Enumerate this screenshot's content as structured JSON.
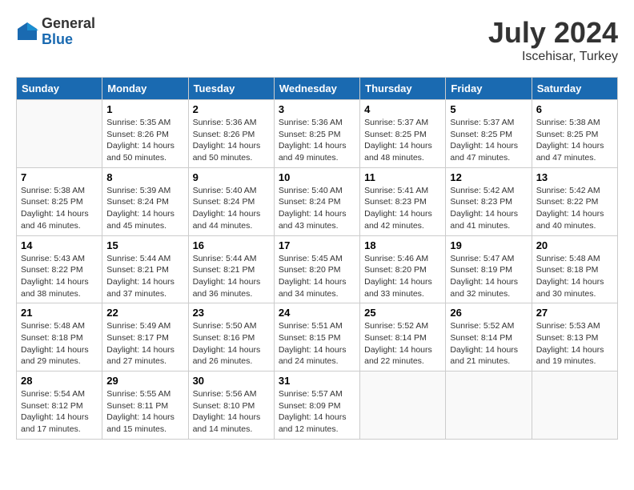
{
  "header": {
    "logo_general": "General",
    "logo_blue": "Blue",
    "month_title": "July 2024",
    "subtitle": "Iscehisar, Turkey"
  },
  "days_of_week": [
    "Sunday",
    "Monday",
    "Tuesday",
    "Wednesday",
    "Thursday",
    "Friday",
    "Saturday"
  ],
  "weeks": [
    [
      {
        "day": "",
        "info": ""
      },
      {
        "day": "1",
        "info": "Sunrise: 5:35 AM\nSunset: 8:26 PM\nDaylight: 14 hours\nand 50 minutes."
      },
      {
        "day": "2",
        "info": "Sunrise: 5:36 AM\nSunset: 8:26 PM\nDaylight: 14 hours\nand 50 minutes."
      },
      {
        "day": "3",
        "info": "Sunrise: 5:36 AM\nSunset: 8:25 PM\nDaylight: 14 hours\nand 49 minutes."
      },
      {
        "day": "4",
        "info": "Sunrise: 5:37 AM\nSunset: 8:25 PM\nDaylight: 14 hours\nand 48 minutes."
      },
      {
        "day": "5",
        "info": "Sunrise: 5:37 AM\nSunset: 8:25 PM\nDaylight: 14 hours\nand 47 minutes."
      },
      {
        "day": "6",
        "info": "Sunrise: 5:38 AM\nSunset: 8:25 PM\nDaylight: 14 hours\nand 47 minutes."
      }
    ],
    [
      {
        "day": "7",
        "info": "Sunrise: 5:38 AM\nSunset: 8:25 PM\nDaylight: 14 hours\nand 46 minutes."
      },
      {
        "day": "8",
        "info": "Sunrise: 5:39 AM\nSunset: 8:24 PM\nDaylight: 14 hours\nand 45 minutes."
      },
      {
        "day": "9",
        "info": "Sunrise: 5:40 AM\nSunset: 8:24 PM\nDaylight: 14 hours\nand 44 minutes."
      },
      {
        "day": "10",
        "info": "Sunrise: 5:40 AM\nSunset: 8:24 PM\nDaylight: 14 hours\nand 43 minutes."
      },
      {
        "day": "11",
        "info": "Sunrise: 5:41 AM\nSunset: 8:23 PM\nDaylight: 14 hours\nand 42 minutes."
      },
      {
        "day": "12",
        "info": "Sunrise: 5:42 AM\nSunset: 8:23 PM\nDaylight: 14 hours\nand 41 minutes."
      },
      {
        "day": "13",
        "info": "Sunrise: 5:42 AM\nSunset: 8:22 PM\nDaylight: 14 hours\nand 40 minutes."
      }
    ],
    [
      {
        "day": "14",
        "info": "Sunrise: 5:43 AM\nSunset: 8:22 PM\nDaylight: 14 hours\nand 38 minutes."
      },
      {
        "day": "15",
        "info": "Sunrise: 5:44 AM\nSunset: 8:21 PM\nDaylight: 14 hours\nand 37 minutes."
      },
      {
        "day": "16",
        "info": "Sunrise: 5:44 AM\nSunset: 8:21 PM\nDaylight: 14 hours\nand 36 minutes."
      },
      {
        "day": "17",
        "info": "Sunrise: 5:45 AM\nSunset: 8:20 PM\nDaylight: 14 hours\nand 34 minutes."
      },
      {
        "day": "18",
        "info": "Sunrise: 5:46 AM\nSunset: 8:20 PM\nDaylight: 14 hours\nand 33 minutes."
      },
      {
        "day": "19",
        "info": "Sunrise: 5:47 AM\nSunset: 8:19 PM\nDaylight: 14 hours\nand 32 minutes."
      },
      {
        "day": "20",
        "info": "Sunrise: 5:48 AM\nSunset: 8:18 PM\nDaylight: 14 hours\nand 30 minutes."
      }
    ],
    [
      {
        "day": "21",
        "info": "Sunrise: 5:48 AM\nSunset: 8:18 PM\nDaylight: 14 hours\nand 29 minutes."
      },
      {
        "day": "22",
        "info": "Sunrise: 5:49 AM\nSunset: 8:17 PM\nDaylight: 14 hours\nand 27 minutes."
      },
      {
        "day": "23",
        "info": "Sunrise: 5:50 AM\nSunset: 8:16 PM\nDaylight: 14 hours\nand 26 minutes."
      },
      {
        "day": "24",
        "info": "Sunrise: 5:51 AM\nSunset: 8:15 PM\nDaylight: 14 hours\nand 24 minutes."
      },
      {
        "day": "25",
        "info": "Sunrise: 5:52 AM\nSunset: 8:14 PM\nDaylight: 14 hours\nand 22 minutes."
      },
      {
        "day": "26",
        "info": "Sunrise: 5:52 AM\nSunset: 8:14 PM\nDaylight: 14 hours\nand 21 minutes."
      },
      {
        "day": "27",
        "info": "Sunrise: 5:53 AM\nSunset: 8:13 PM\nDaylight: 14 hours\nand 19 minutes."
      }
    ],
    [
      {
        "day": "28",
        "info": "Sunrise: 5:54 AM\nSunset: 8:12 PM\nDaylight: 14 hours\nand 17 minutes."
      },
      {
        "day": "29",
        "info": "Sunrise: 5:55 AM\nSunset: 8:11 PM\nDaylight: 14 hours\nand 15 minutes."
      },
      {
        "day": "30",
        "info": "Sunrise: 5:56 AM\nSunset: 8:10 PM\nDaylight: 14 hours\nand 14 minutes."
      },
      {
        "day": "31",
        "info": "Sunrise: 5:57 AM\nSunset: 8:09 PM\nDaylight: 14 hours\nand 12 minutes."
      },
      {
        "day": "",
        "info": ""
      },
      {
        "day": "",
        "info": ""
      },
      {
        "day": "",
        "info": ""
      }
    ]
  ]
}
